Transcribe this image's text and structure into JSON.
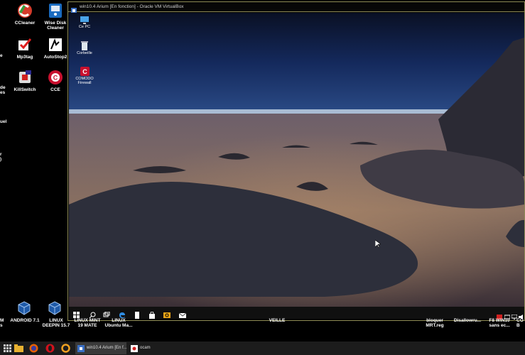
{
  "host_desktop": {
    "icons": [
      {
        "name": "ccleaner",
        "label": "CCleaner"
      },
      {
        "name": "wise-disk-cleaner",
        "label": "Wise Disk\nCleaner"
      },
      {
        "name": "mp3tag",
        "label": "Mp3tag"
      },
      {
        "name": "autostop",
        "label": "AutoStop2"
      },
      {
        "name": "killswitch",
        "label": "KillSwitch"
      },
      {
        "name": "cce",
        "label": "CCE"
      }
    ],
    "partial_labels": [
      "e",
      "de\nes",
      "uel",
      "r\n)"
    ],
    "bottom_labels": [
      {
        "name": "label-m-partial",
        "text": "M\ns"
      },
      {
        "name": "android",
        "text": "ANDROID 7.1"
      },
      {
        "name": "linux-deepin",
        "text": "LINUX\nDEEPIN 15.7"
      },
      {
        "name": "linux-mint",
        "text": "LINUX MINT\n19 MATE"
      },
      {
        "name": "linux-ubuntu",
        "text": "LINUX\nUbuntu Ma..."
      },
      {
        "name": "veille",
        "text": "VEILLE"
      },
      {
        "name": "bloquer",
        "text": "bloquer\nMRT.reg"
      },
      {
        "name": "disallow",
        "text": "Disallowru..."
      },
      {
        "name": "f8-win10",
        "text": "F8 WIN10\nsans ec..."
      },
      {
        "name": "co-partial",
        "text": "CO\nB"
      }
    ]
  },
  "vm_window": {
    "title": "win10.4 Arium [En fonction] - Oracle VM VirtualBox",
    "guest_icons": [
      {
        "name": "ce-pc",
        "label": "Ce PC"
      },
      {
        "name": "corbeille",
        "label": "Corbeille"
      },
      {
        "name": "comodo-firewall",
        "label": "COMODO\nFirewall"
      }
    ]
  },
  "host_taskbar": {
    "buttons": [
      {
        "name": "vbox-task",
        "label": "win10.4 Arium [En f..."
      },
      {
        "name": "ocam-task",
        "label": "ocam"
      }
    ]
  },
  "colors": {
    "vm_border": "#8e8b55",
    "taskbar": "#1c1c1c"
  }
}
